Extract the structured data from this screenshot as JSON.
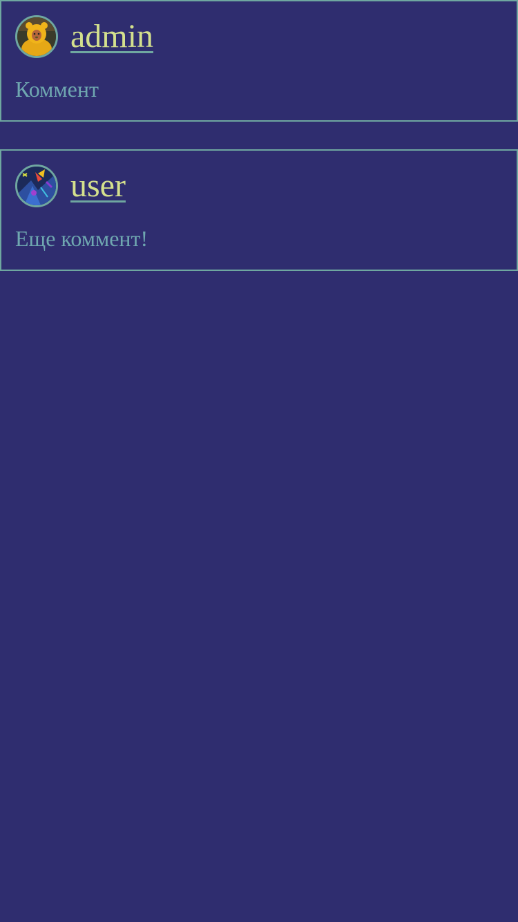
{
  "comments": [
    {
      "username": "admin",
      "text": "Коммент",
      "avatar": "bear-costume-avatar"
    },
    {
      "username": "user",
      "text": "Еще коммент!",
      "avatar": "colorful-abstract-avatar"
    }
  ],
  "colors": {
    "background": "#2f2d6f",
    "border": "#6fa7a0",
    "username": "#d4e08d",
    "comment_text": "#6fa7b0"
  }
}
